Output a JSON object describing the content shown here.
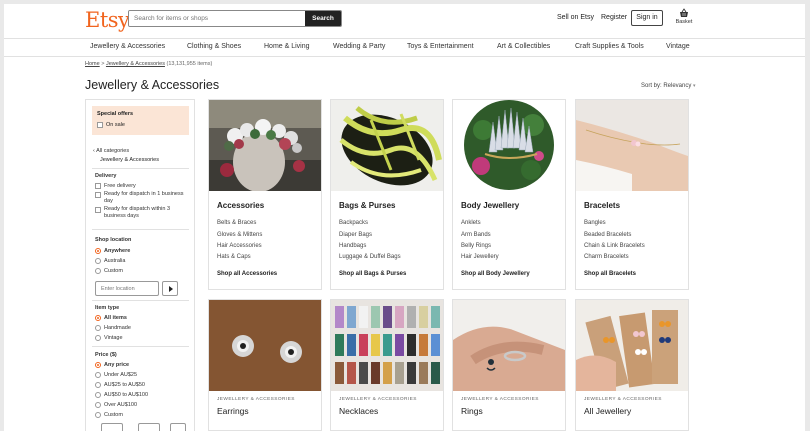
{
  "header": {
    "logo": "Etsy",
    "search_placeholder": "Search for items or shops",
    "search_button": "Search",
    "sell": "Sell on Etsy",
    "register": "Register",
    "sign_in": "Sign in",
    "basket": "Basket"
  },
  "nav": [
    "Jewellery & Accessories",
    "Clothing & Shoes",
    "Home & Living",
    "Wedding & Party",
    "Toys & Entertainment",
    "Art & Collectibles",
    "Craft Supplies & Tools",
    "Vintage"
  ],
  "breadcrumb": {
    "home": "Home",
    "sep": ">",
    "current": "Jewellery & Accessories",
    "count": "(13,131,955 items)"
  },
  "page_title": "Jewellery & Accessories",
  "sort": "Sort by: Relevancy",
  "sidebar": {
    "special_offers": "Special offers",
    "on_sale": "On sale",
    "all_categories": "All categories",
    "current_category": "Jewellery & Accessories",
    "delivery": {
      "title": "Delivery",
      "options": [
        "Free delivery",
        "Ready for dispatch in 1 business day",
        "Ready for dispatch within 3 business days"
      ]
    },
    "shop_location": {
      "title": "Shop location",
      "options": [
        "Anywhere",
        "Australia",
        "Custom"
      ],
      "selected": "Anywhere",
      "placeholder": "Enter location"
    },
    "item_type": {
      "title": "Item type",
      "options": [
        "All items",
        "Handmade",
        "Vintage"
      ],
      "selected": "All items"
    },
    "price": {
      "title": "Price ($)",
      "options": [
        "Any price",
        "Under AU$25",
        "AU$25 to AU$50",
        "AU$50 to AU$100",
        "Over AU$100",
        "Custom"
      ],
      "selected": "Any price"
    }
  },
  "cards": [
    {
      "title": "Accessories",
      "links": [
        "Belts & Braces",
        "Gloves & Mittens",
        "Hair Accessories",
        "Hats & Caps"
      ],
      "shop_all": "Shop all Accessories"
    },
    {
      "title": "Bags & Purses",
      "links": [
        "Backpacks",
        "Diaper Bags",
        "Handbags",
        "Luggage & Duffel Bags"
      ],
      "shop_all": "Shop all Bags & Purses"
    },
    {
      "title": "Body Jewellery",
      "links": [
        "Anklets",
        "Arm Bands",
        "Belly Rings",
        "Hair Jewellery"
      ],
      "shop_all": "Shop all Body Jewellery"
    },
    {
      "title": "Bracelets",
      "links": [
        "Bangles",
        "Beaded Bracelets",
        "Chain & Link Bracelets",
        "Charm Bracelets"
      ],
      "shop_all": "Shop all Bracelets"
    }
  ],
  "cards2": [
    {
      "category": "JEWELLERY & ACCESSORIES",
      "name": "Earrings"
    },
    {
      "category": "JEWELLERY & ACCESSORIES",
      "name": "Necklaces"
    },
    {
      "category": "JEWELLERY & ACCESSORIES",
      "name": "Rings"
    },
    {
      "category": "JEWELLERY & ACCESSORIES",
      "name": "All Jewellery"
    }
  ],
  "colors": {
    "brand": "#f1641e",
    "offer_bg": "#fbe5d6",
    "search_button": "#222222"
  }
}
